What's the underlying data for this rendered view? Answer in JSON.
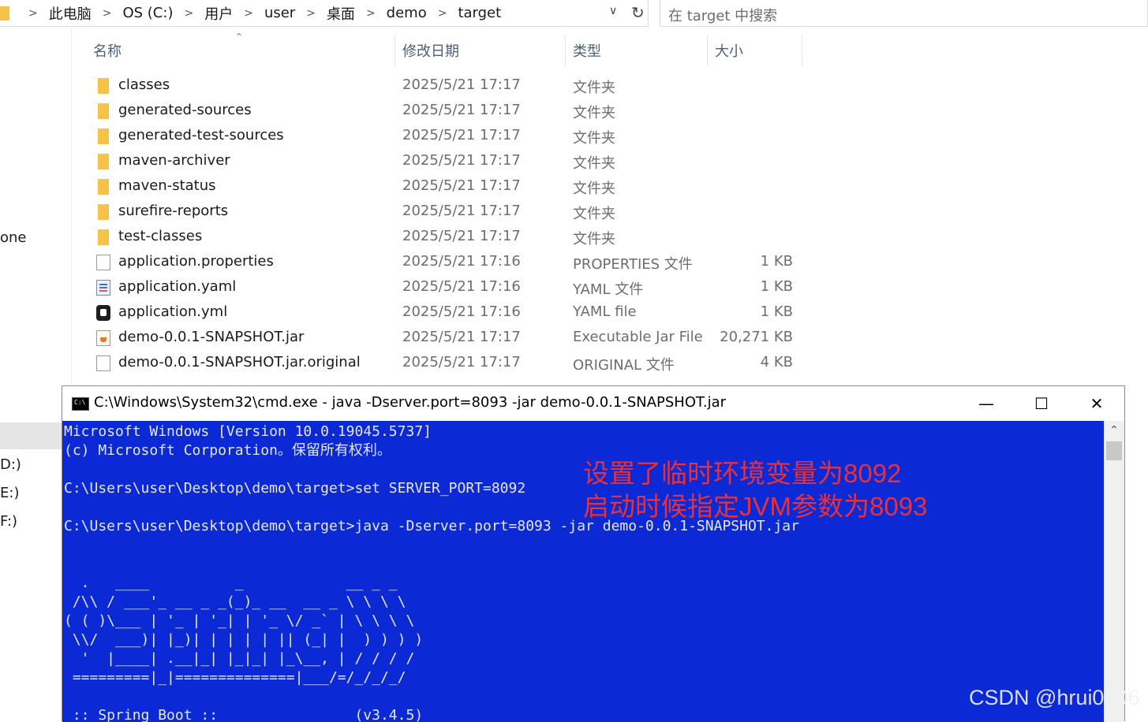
{
  "explorer": {
    "breadcrumb": [
      "此电脑",
      "OS (C:)",
      "用户",
      "user",
      "桌面",
      "demo",
      "target"
    ],
    "search_placeholder": "在 target 中搜索",
    "sidebar_fragments": [
      "one",
      "D:)",
      "E:)",
      "F:)"
    ],
    "columns": {
      "name": "名称",
      "date": "修改日期",
      "type": "类型",
      "size": "大小"
    },
    "files": [
      {
        "icon": "folder-icon",
        "name": "classes",
        "date": "2025/5/21 17:17",
        "type": "文件夹",
        "size": ""
      },
      {
        "icon": "folder-icon",
        "name": "generated-sources",
        "date": "2025/5/21 17:17",
        "type": "文件夹",
        "size": ""
      },
      {
        "icon": "folder-icon",
        "name": "generated-test-sources",
        "date": "2025/5/21 17:17",
        "type": "文件夹",
        "size": ""
      },
      {
        "icon": "folder-icon",
        "name": "maven-archiver",
        "date": "2025/5/21 17:17",
        "type": "文件夹",
        "size": ""
      },
      {
        "icon": "folder-icon",
        "name": "maven-status",
        "date": "2025/5/21 17:17",
        "type": "文件夹",
        "size": ""
      },
      {
        "icon": "folder-icon",
        "name": "surefire-reports",
        "date": "2025/5/21 17:17",
        "type": "文件夹",
        "size": ""
      },
      {
        "icon": "folder-icon",
        "name": "test-classes",
        "date": "2025/5/21 17:17",
        "type": "文件夹",
        "size": ""
      },
      {
        "icon": "file-icon",
        "name": "application.properties",
        "date": "2025/5/21 17:16",
        "type": "PROPERTIES 文件",
        "size": "1 KB"
      },
      {
        "icon": "yaml-file-icon",
        "name": "application.yaml",
        "date": "2025/5/21 17:16",
        "type": "YAML 文件",
        "size": "1 KB"
      },
      {
        "icon": "yml-file-icon",
        "name": "application.yml",
        "date": "2025/5/21 17:16",
        "type": "YAML file",
        "size": "1 KB"
      },
      {
        "icon": "jar-file-icon",
        "name": "demo-0.0.1-SNAPSHOT.jar",
        "date": "2025/5/21 17:17",
        "type": "Executable Jar File",
        "size": "20,271 KB"
      },
      {
        "icon": "file-icon",
        "name": "demo-0.0.1-SNAPSHOT.jar.original",
        "date": "2025/5/21 17:17",
        "type": "ORIGINAL 文件",
        "size": "4 KB"
      }
    ]
  },
  "cmd": {
    "title": "C:\\Windows\\System32\\cmd.exe - java  -Dserver.port=8093 -jar demo-0.0.1-SNAPSHOT.jar",
    "minimize": "—",
    "maximize": "☐",
    "close": "✕",
    "output": "Microsoft Windows [Version 10.0.19045.5737]\n(c) Microsoft Corporation。保留所有权利。\n\nC:\\Users\\user\\Desktop\\demo\\target>set SERVER_PORT=8092\n\nC:\\Users\\user\\Desktop\\demo\\target>java -Dserver.port=8093 -jar demo-0.0.1-SNAPSHOT.jar\n\n\n  .   ____          _            __ _ _\n /\\\\ / ___'_ __ _ _(_)_ __  __ _ \\ \\ \\ \\\n( ( )\\___ | '_ | '_| | '_ \\/ _` | \\ \\ \\ \\\n \\\\/  ___)| |_)| | | | | || (_| |  ) ) ) )\n  '  |____| .__|_| |_|_| |_\\__, | / / / /\n =========|_|==============|___/=/_/_/_/\n\n :: Spring Boot ::                (v3.4.5)"
  },
  "annotations": {
    "line1": "设置了临时环境变量为8092",
    "line2": "启动时候指定JVM参数为8093"
  },
  "watermark": "CSDN @hrui0706"
}
